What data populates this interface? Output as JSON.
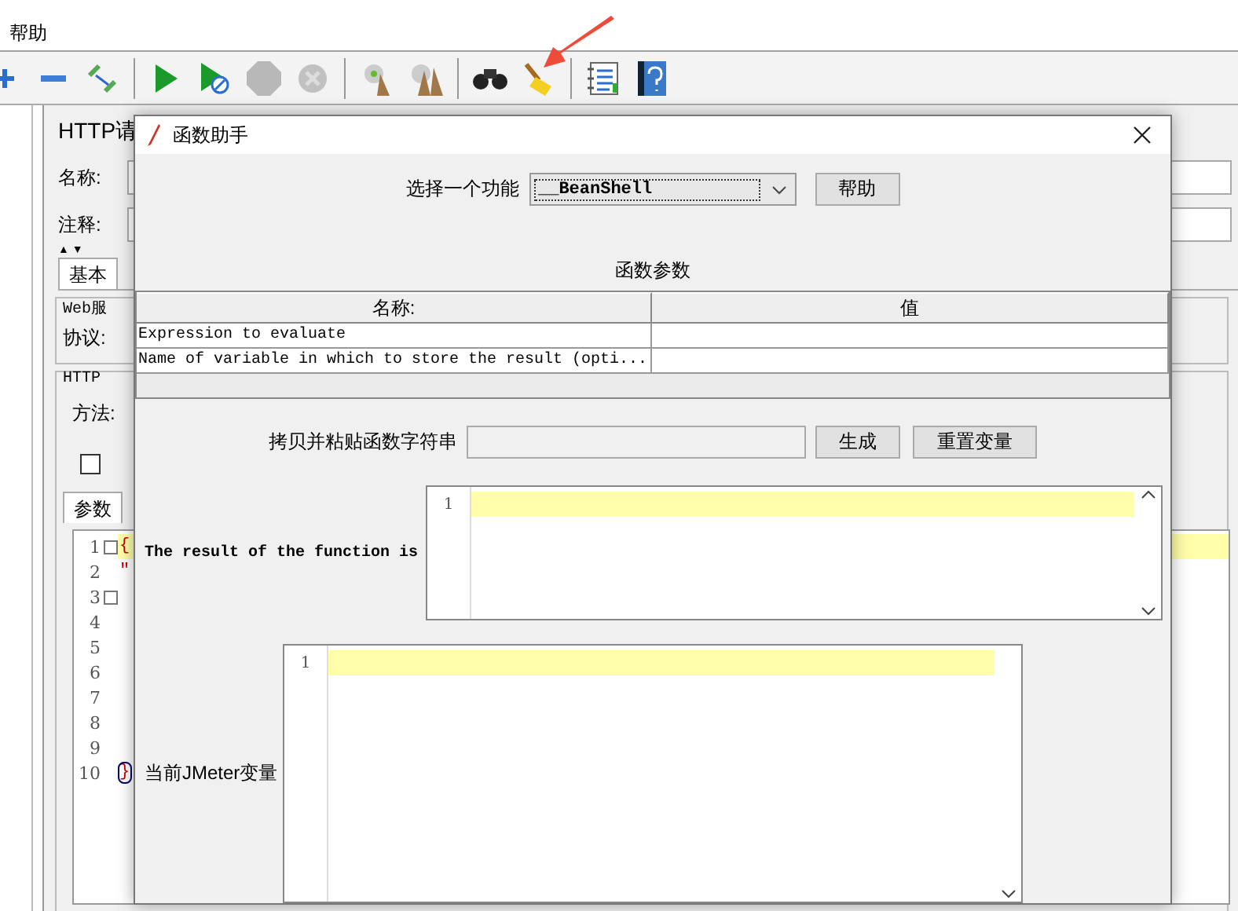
{
  "menu": [
    {
      "label": "帮助"
    }
  ],
  "toolbar": [
    {
      "kind": "add",
      "disabled": false
    },
    {
      "kind": "remove",
      "disabled": false
    },
    {
      "kind": "toggle",
      "disabled": false
    },
    {
      "kind": "sep"
    },
    {
      "kind": "start",
      "disabled": false
    },
    {
      "kind": "start-nopause",
      "disabled": false
    },
    {
      "kind": "stop",
      "disabled": true
    },
    {
      "kind": "shutdown",
      "disabled": true
    },
    {
      "kind": "sep"
    },
    {
      "kind": "clear",
      "disabled": false
    },
    {
      "kind": "clear-all",
      "disabled": false
    },
    {
      "kind": "sep"
    },
    {
      "kind": "search",
      "disabled": false
    },
    {
      "kind": "reset-search",
      "disabled": false
    },
    {
      "kind": "sep"
    },
    {
      "kind": "function-helper",
      "disabled": false
    },
    {
      "kind": "help",
      "disabled": false
    }
  ],
  "panel": {
    "title": "HTTP请",
    "name_label": "名称:",
    "comment_label": "注释:",
    "collapse_arrows": "▲▼",
    "tabs": [
      {
        "label": "基本",
        "selected": true
      }
    ],
    "web_server": {
      "legend": "Web服",
      "protocol_label": "协议:"
    },
    "http_request": {
      "legend": "HTTP",
      "method_label": "方法:"
    },
    "auto_checkbox": {
      "checked": false
    },
    "body_tabs": [
      {
        "label": "参数",
        "selected": true
      }
    ],
    "editor": {
      "lines": [
        {
          "number": "1",
          "text": "{",
          "fold": true,
          "current": true
        },
        {
          "number": "2",
          "text": "\"",
          "fold": false,
          "current": false
        },
        {
          "number": "3",
          "fold": true,
          "current": false
        },
        {
          "number": "4",
          "fold": false,
          "current": false
        },
        {
          "number": "5",
          "fold": false,
          "current": false
        },
        {
          "number": "6",
          "fold": false,
          "current": false
        },
        {
          "number": "7",
          "fold": false,
          "current": false
        },
        {
          "number": "8",
          "fold": false,
          "current": false
        },
        {
          "number": "9",
          "fold": false,
          "current": false
        },
        {
          "number": "10",
          "text": "}",
          "fold": false,
          "current": false,
          "bracket": true
        }
      ]
    }
  },
  "dialog": {
    "title": "函数助手",
    "function_label": "选择一个功能",
    "function_value": "__BeanShell",
    "help_button": "帮助",
    "params_title": "函数参数",
    "table": {
      "columns": [
        "名称:",
        "值"
      ],
      "rows": [
        {
          "name": "Expression to evaluate"
        },
        {
          "name": "Name of variable in which to store the result (opti..."
        }
      ]
    },
    "copy_label": "拷贝并粘贴函数字符串",
    "generate_button": "生成",
    "reset_button": "重置变量",
    "result_label": "The result of the function is",
    "result_editor": {
      "lines": [
        "1"
      ]
    },
    "vars_label": "当前JMeter变量",
    "vars_editor": {
      "lines": [
        "1"
      ]
    }
  }
}
